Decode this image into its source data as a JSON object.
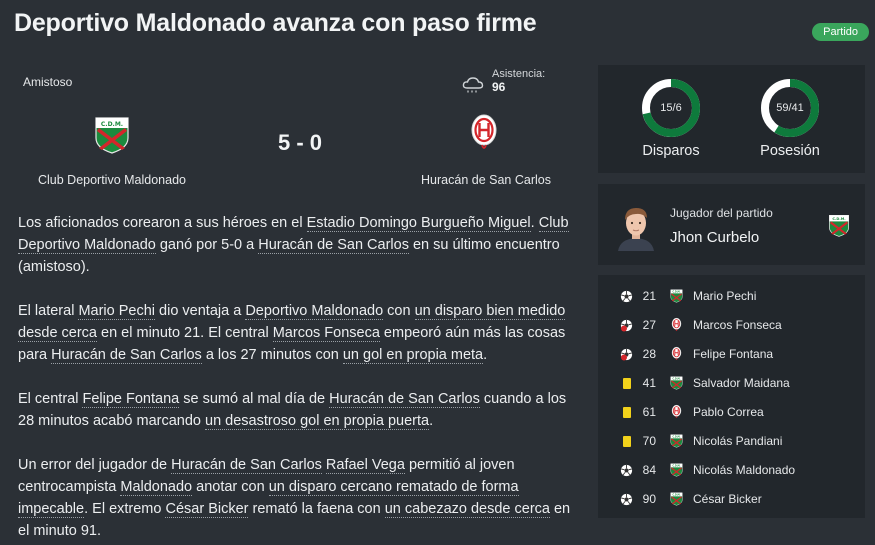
{
  "headline": "Deportivo Maldonado avanza con paso firme",
  "tag": "Partido",
  "match": {
    "competition": "Amistoso",
    "attendance_label": "Asistencia:",
    "attendance_value": "96",
    "score": "5 - 0",
    "home_team": "Club Deportivo Maldonado",
    "away_team": "Huracán de San Carlos"
  },
  "article": {
    "p1": {
      "t1": "Los aficionados corearon a sus héroes en el ",
      "l1": "Estadio Domingo Burgueño Miguel",
      "t2": ". ",
      "l2": "Club Deportivo Maldonado",
      "t3": " ganó por 5-0 a ",
      "l3": "Huracán de San Carlos",
      "t4": " en su último encuentro (amistoso)."
    },
    "p2": {
      "t1": "El lateral ",
      "l1": "Mario Pechi",
      "t2": " dio ventaja a ",
      "l2": "Deportivo Maldonado",
      "t3": " con ",
      "l3": "un disparo bien medido desde cerca",
      "t4": " en el minuto 21. El central ",
      "l4": "Marcos Fonseca",
      "t5": " empeoró aún más las cosas para ",
      "l5": "Huracán de San Carlos",
      "t6": " a los 27 minutos con ",
      "l6": "un gol en propia meta",
      "t7": "."
    },
    "p3": {
      "t1": "El central ",
      "l1": "Felipe Fontana",
      "t2": " se sumó al mal día de ",
      "l2": "Huracán de San Carlos",
      "t3": " cuando a los 28 minutos acabó marcando ",
      "l3": "un desastroso gol en propia puerta",
      "t4": "."
    },
    "p4": {
      "t1": "Un error del jugador de ",
      "l1": "Huracán de San Carlos",
      "t2": " ",
      "l2": "Rafael Vega",
      "t3": " permitió al joven centrocampista ",
      "l3": "Maldonado",
      "t4": " anotar con ",
      "l4": "un disparo cercano rematado de forma impecable",
      "t5": ". El extremo ",
      "l5": "César Bicker",
      "t6": " remató la faena con ",
      "l6": "un cabezazo desde cerca",
      "t7": " en el minuto 91."
    }
  },
  "stats": {
    "shots": {
      "text": "15/6",
      "label": "Disparos",
      "home_share": 0.714
    },
    "possession": {
      "text": "59/41",
      "label": "Posesión",
      "home_share": 0.59
    }
  },
  "potm": {
    "label": "Jugador del partido",
    "name": "Jhon Curbelo"
  },
  "events": [
    {
      "type": "goal",
      "minute": "21",
      "team": "home",
      "player": "Mario Pechi"
    },
    {
      "type": "own-goal",
      "minute": "27",
      "team": "away",
      "player": "Marcos Fonseca"
    },
    {
      "type": "own-goal",
      "minute": "28",
      "team": "away",
      "player": "Felipe Fontana"
    },
    {
      "type": "yellow-card",
      "minute": "41",
      "team": "home",
      "player": "Salvador Maidana"
    },
    {
      "type": "yellow-card",
      "minute": "61",
      "team": "away",
      "player": "Pablo Correa"
    },
    {
      "type": "yellow-card",
      "minute": "70",
      "team": "home",
      "player": "Nicolás Pandiani"
    },
    {
      "type": "goal",
      "minute": "84",
      "team": "home",
      "player": "Nicolás Maldonado"
    },
    {
      "type": "goal",
      "minute": "90",
      "team": "home",
      "player": "César Bicker"
    }
  ],
  "colors": {
    "background": "#2b3036",
    "panel": "#22272c",
    "home_green": "#0e7a3c",
    "away_ring": "#ffffff",
    "tag_green": "#3aa65c",
    "yellow_card": "#f2d21b"
  }
}
